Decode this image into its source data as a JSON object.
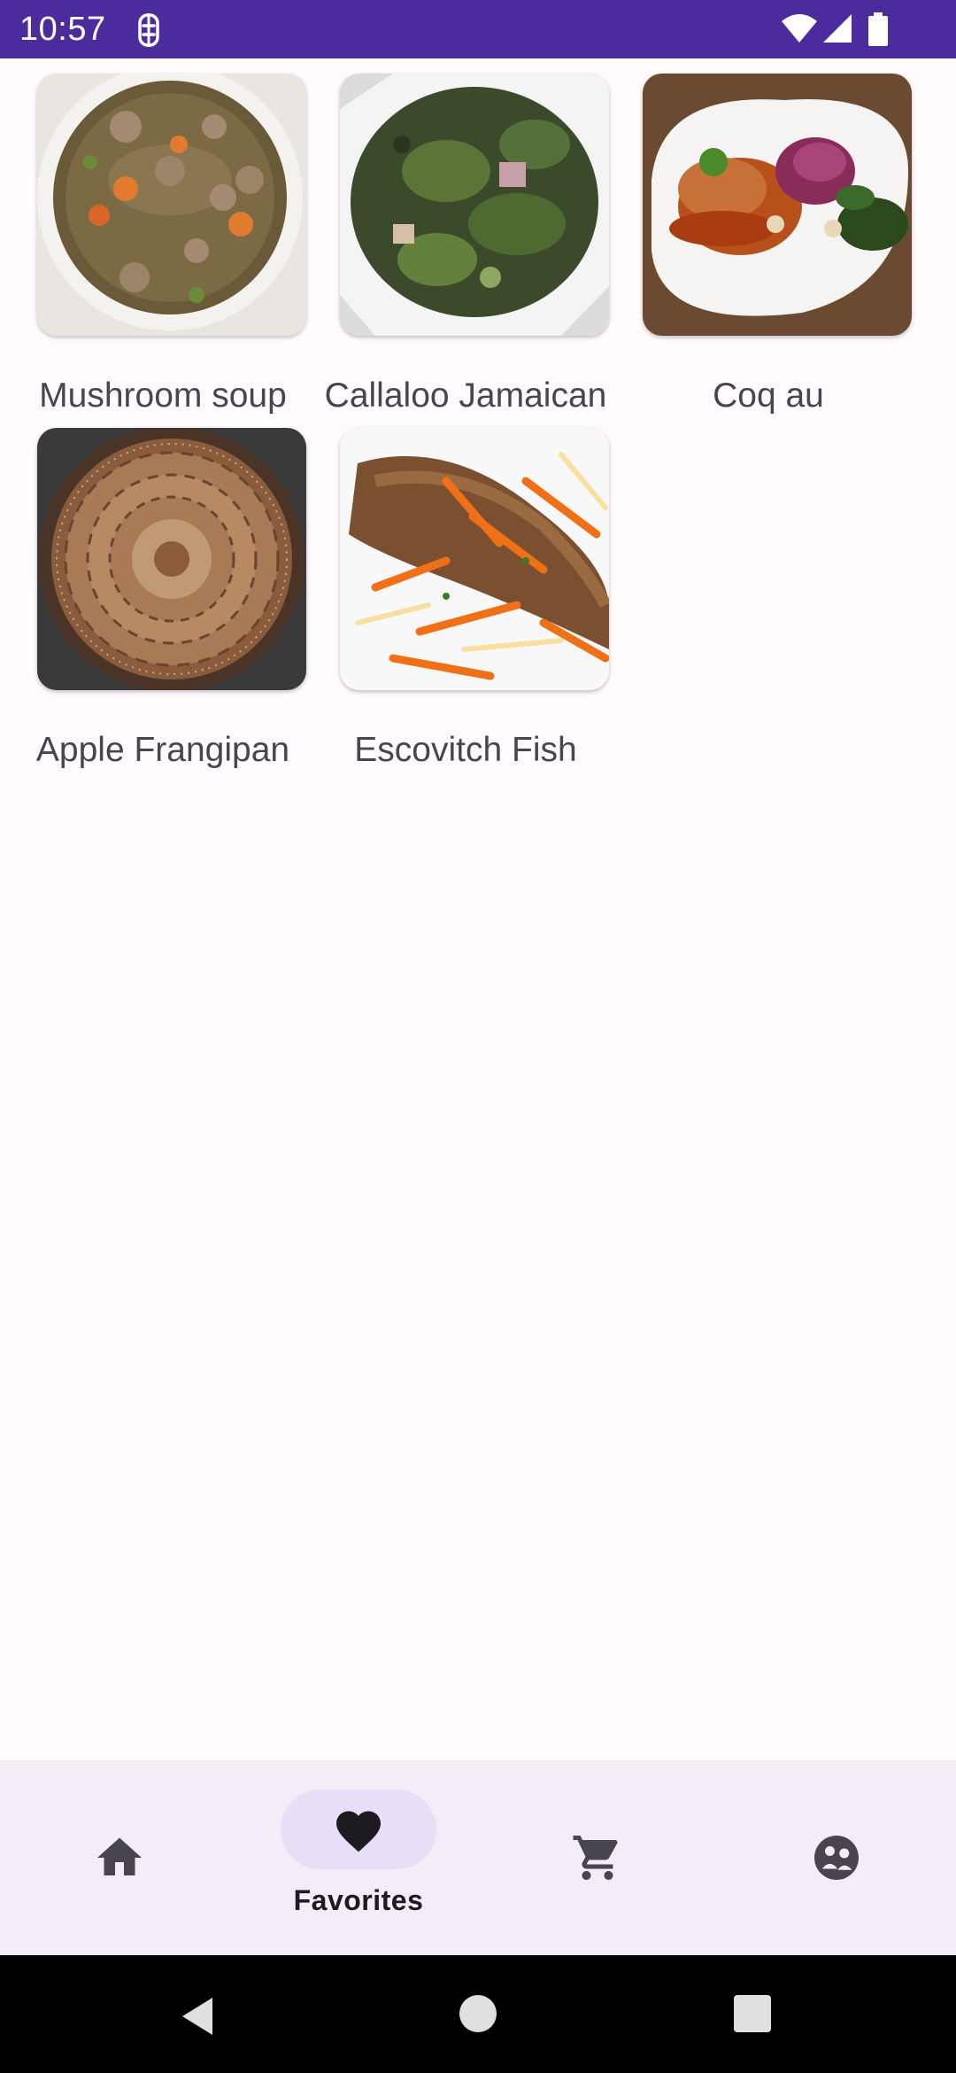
{
  "status_bar": {
    "time": "10:57",
    "background_color": "#4c2b9c",
    "icons": [
      "app-notification-icon",
      "wifi-icon",
      "signal-icon",
      "battery-icon"
    ]
  },
  "favorites": [
    {
      "title": "Mushroom soup",
      "image": "mushroom-soup-photo"
    },
    {
      "title": "Callaloo Jamaican",
      "image": "callaloo-photo"
    },
    {
      "title": "Coq au",
      "image": "coq-au-vin-photo"
    },
    {
      "title": "Apple Frangipan",
      "image": "apple-frangipan-photo"
    },
    {
      "title": "Escovitch Fish",
      "image": "escovitch-fish-photo"
    }
  ],
  "bottom_nav": {
    "items": [
      {
        "id": "home",
        "icon": "home-icon",
        "label": "",
        "active": false
      },
      {
        "id": "favorites",
        "icon": "heart-icon",
        "label": "Favorites",
        "active": true
      },
      {
        "id": "cart",
        "icon": "cart-icon",
        "label": "",
        "active": false
      },
      {
        "id": "profile",
        "icon": "profile-icon",
        "label": "",
        "active": false
      }
    ],
    "background_color": "#f3edf7",
    "active_pill_color": "#e8def8"
  },
  "system_nav": {
    "icons": [
      "back-icon",
      "home-circle-icon",
      "recents-icon"
    ]
  }
}
